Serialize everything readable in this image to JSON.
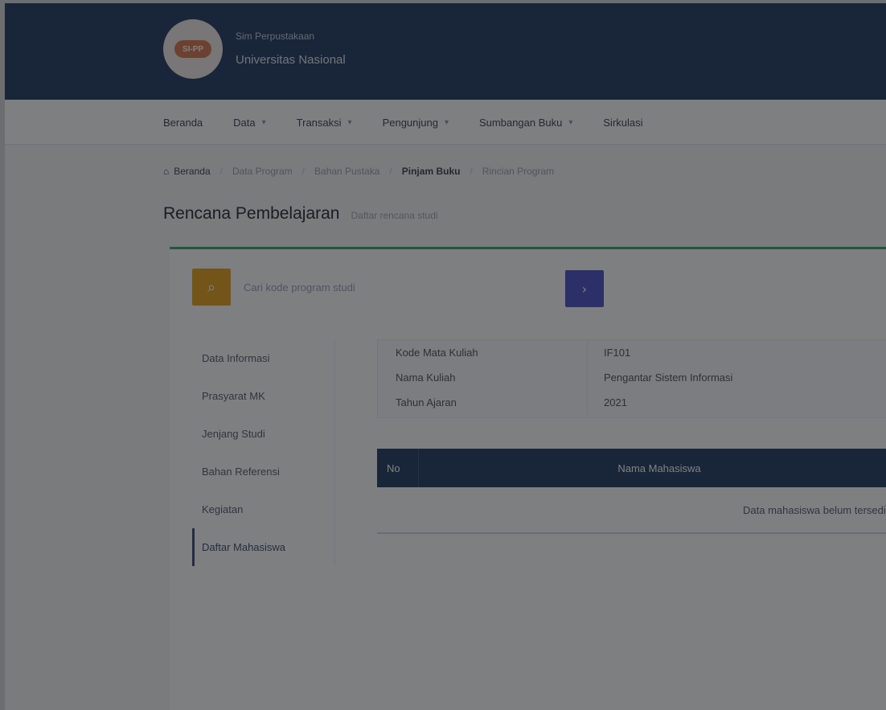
{
  "header": {
    "logo_text": "SI-PP",
    "org_small": "Sim Perpustakaan",
    "org_name": "Universitas Nasional"
  },
  "nav": {
    "items": [
      {
        "label": "Beranda",
        "has_menu": false
      },
      {
        "label": "Data",
        "has_menu": true
      },
      {
        "label": "Transaksi",
        "has_menu": true
      },
      {
        "label": "Pengunjung",
        "has_menu": true
      },
      {
        "label": "Sumbangan Buku",
        "has_menu": true
      },
      {
        "label": "Sirkulasi",
        "has_menu": true
      }
    ]
  },
  "breadcrumb": {
    "home": "Beranda",
    "items": [
      "Data Program",
      "Bahan Pustaka",
      "Pinjam Buku",
      "Rincian Program"
    ]
  },
  "page": {
    "title": "Rencana Pembelajaran",
    "subtitle": "Daftar rencana studi"
  },
  "search": {
    "placeholder": "Cari kode program studi",
    "go_label": "›"
  },
  "side_menu": {
    "items": [
      {
        "label": "Data Informasi",
        "active": false
      },
      {
        "label": "Prasyarat MK",
        "active": false
      },
      {
        "label": "Jenjang Studi",
        "active": false
      },
      {
        "label": "Bahan Referensi",
        "active": false
      },
      {
        "label": "Kegiatan",
        "active": false
      },
      {
        "label": "Daftar Mahasiswa",
        "active": true
      }
    ]
  },
  "info": {
    "rows": [
      {
        "label": "Kode Mata Kuliah",
        "value": "IF101"
      },
      {
        "label": "Nama Kuliah",
        "value": "Pengantar Sistem Informasi"
      },
      {
        "label": "Tahun Ajaran",
        "value": "2021"
      }
    ]
  },
  "table": {
    "col_no": "No",
    "col_name": "Nama Mahasiswa",
    "empty_text": "Data mahasiswa belum tersedia"
  }
}
